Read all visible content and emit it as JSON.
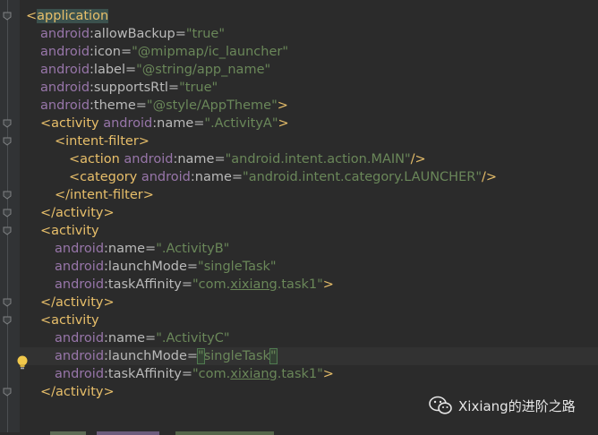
{
  "editor": {
    "lines": [
      {
        "indent": 0,
        "segments": [
          {
            "t": "<",
            "c": "c-tag"
          },
          {
            "t": "application",
            "c": "tag-bg"
          }
        ]
      },
      {
        "indent": 1,
        "segments": [
          {
            "t": "android",
            "c": "c-ns"
          },
          {
            "t": ":allowBackup=",
            "c": "c-attr"
          },
          {
            "t": "\"true\"",
            "c": "c-val"
          }
        ]
      },
      {
        "indent": 1,
        "segments": [
          {
            "t": "android",
            "c": "c-ns"
          },
          {
            "t": ":icon=",
            "c": "c-attr"
          },
          {
            "t": "\"@mipmap/ic_launcher\"",
            "c": "c-val"
          }
        ]
      },
      {
        "indent": 1,
        "segments": [
          {
            "t": "android",
            "c": "c-ns"
          },
          {
            "t": ":label=",
            "c": "c-attr"
          },
          {
            "t": "\"@string/app_name\"",
            "c": "c-val"
          }
        ]
      },
      {
        "indent": 1,
        "segments": [
          {
            "t": "android",
            "c": "c-ns"
          },
          {
            "t": ":supportsRtl=",
            "c": "c-attr"
          },
          {
            "t": "\"true\"",
            "c": "c-val"
          }
        ]
      },
      {
        "indent": 1,
        "segments": [
          {
            "t": "android",
            "c": "c-ns"
          },
          {
            "t": ":theme=",
            "c": "c-attr"
          },
          {
            "t": "\"@style/AppTheme\"",
            "c": "c-val"
          },
          {
            "t": ">",
            "c": "c-tag"
          }
        ]
      },
      {
        "indent": 1,
        "segments": [
          {
            "t": "<activity ",
            "c": "c-tag"
          },
          {
            "t": "android",
            "c": "c-ns"
          },
          {
            "t": ":name=",
            "c": "c-attr"
          },
          {
            "t": "\".ActivityA\"",
            "c": "c-val"
          },
          {
            "t": ">",
            "c": "c-tag"
          }
        ]
      },
      {
        "indent": 2,
        "segments": [
          {
            "t": "<intent-filter>",
            "c": "c-tag"
          }
        ]
      },
      {
        "indent": 3,
        "segments": [
          {
            "t": "<action ",
            "c": "c-tag"
          },
          {
            "t": "android",
            "c": "c-ns"
          },
          {
            "t": ":name=",
            "c": "c-attr"
          },
          {
            "t": "\"android.intent.action.MAIN\"",
            "c": "c-val"
          },
          {
            "t": "/>",
            "c": "c-tag"
          }
        ]
      },
      {
        "indent": 3,
        "segments": [
          {
            "t": "<category ",
            "c": "c-tag"
          },
          {
            "t": "android",
            "c": "c-ns"
          },
          {
            "t": ":name=",
            "c": "c-attr"
          },
          {
            "t": "\"android.intent.category.LAUNCHER\"",
            "c": "c-val"
          },
          {
            "t": "/>",
            "c": "c-tag"
          }
        ]
      },
      {
        "indent": 2,
        "segments": [
          {
            "t": "</intent-filter>",
            "c": "c-tag"
          }
        ]
      },
      {
        "indent": 1,
        "segments": [
          {
            "t": "</activity>",
            "c": "c-tag"
          }
        ]
      },
      {
        "indent": 1,
        "segments": [
          {
            "t": "<activity",
            "c": "c-tag"
          }
        ]
      },
      {
        "indent": 2,
        "segments": [
          {
            "t": "android",
            "c": "c-ns"
          },
          {
            "t": ":name=",
            "c": "c-attr"
          },
          {
            "t": "\".ActivityB\"",
            "c": "c-val"
          }
        ]
      },
      {
        "indent": 2,
        "segments": [
          {
            "t": "android",
            "c": "c-ns"
          },
          {
            "t": ":launchMode=",
            "c": "c-attr"
          },
          {
            "t": "\"singleTask\"",
            "c": "c-val"
          }
        ]
      },
      {
        "indent": 2,
        "segments": [
          {
            "t": "android",
            "c": "c-ns"
          },
          {
            "t": ":taskAffinity=",
            "c": "c-attr"
          },
          {
            "t": "\"com.",
            "c": "c-val"
          },
          {
            "t": "xixiang",
            "c": "c-val underline"
          },
          {
            "t": ".task1\"",
            "c": "c-val"
          },
          {
            "t": ">",
            "c": "c-tag"
          }
        ]
      },
      {
        "indent": 1,
        "segments": [
          {
            "t": "</activity>",
            "c": "c-tag"
          }
        ]
      },
      {
        "indent": 1,
        "segments": [
          {
            "t": "<activity",
            "c": "c-tag"
          }
        ]
      },
      {
        "indent": 2,
        "segments": [
          {
            "t": "android",
            "c": "c-ns"
          },
          {
            "t": ":name=",
            "c": "c-attr"
          },
          {
            "t": "\".ActivityC\"",
            "c": "c-val"
          }
        ]
      },
      {
        "indent": 2,
        "current": true,
        "segments": [
          {
            "t": "android",
            "c": "c-ns"
          },
          {
            "t": ":launchMode=",
            "c": "c-attr"
          },
          {
            "t": "\"",
            "c": "c-val caret-quote"
          },
          {
            "t": "singleTask",
            "c": "c-val"
          },
          {
            "t": "\"",
            "c": "c-val caret-quote"
          }
        ]
      },
      {
        "indent": 2,
        "segments": [
          {
            "t": "android",
            "c": "c-ns"
          },
          {
            "t": ":taskAffinity=",
            "c": "c-attr"
          },
          {
            "t": "\"com.",
            "c": "c-val"
          },
          {
            "t": "xixiang",
            "c": "c-val underline"
          },
          {
            "t": ".task1\"",
            "c": "c-val"
          },
          {
            "t": ">",
            "c": "c-tag"
          }
        ]
      },
      {
        "indent": 1,
        "segments": [
          {
            "t": "</activity>",
            "c": "c-tag"
          }
        ]
      }
    ],
    "colors": {
      "background": "#2b2b2b",
      "tag": "#e8bf6a",
      "namespace": "#9876aa",
      "attribute": "#bababa",
      "value": "#6a8759"
    }
  },
  "watermark": {
    "text": "Xixiang的进阶之路",
    "icon": "wechat-icon"
  },
  "gutter": {
    "intention_icon": "lightbulb-icon"
  }
}
